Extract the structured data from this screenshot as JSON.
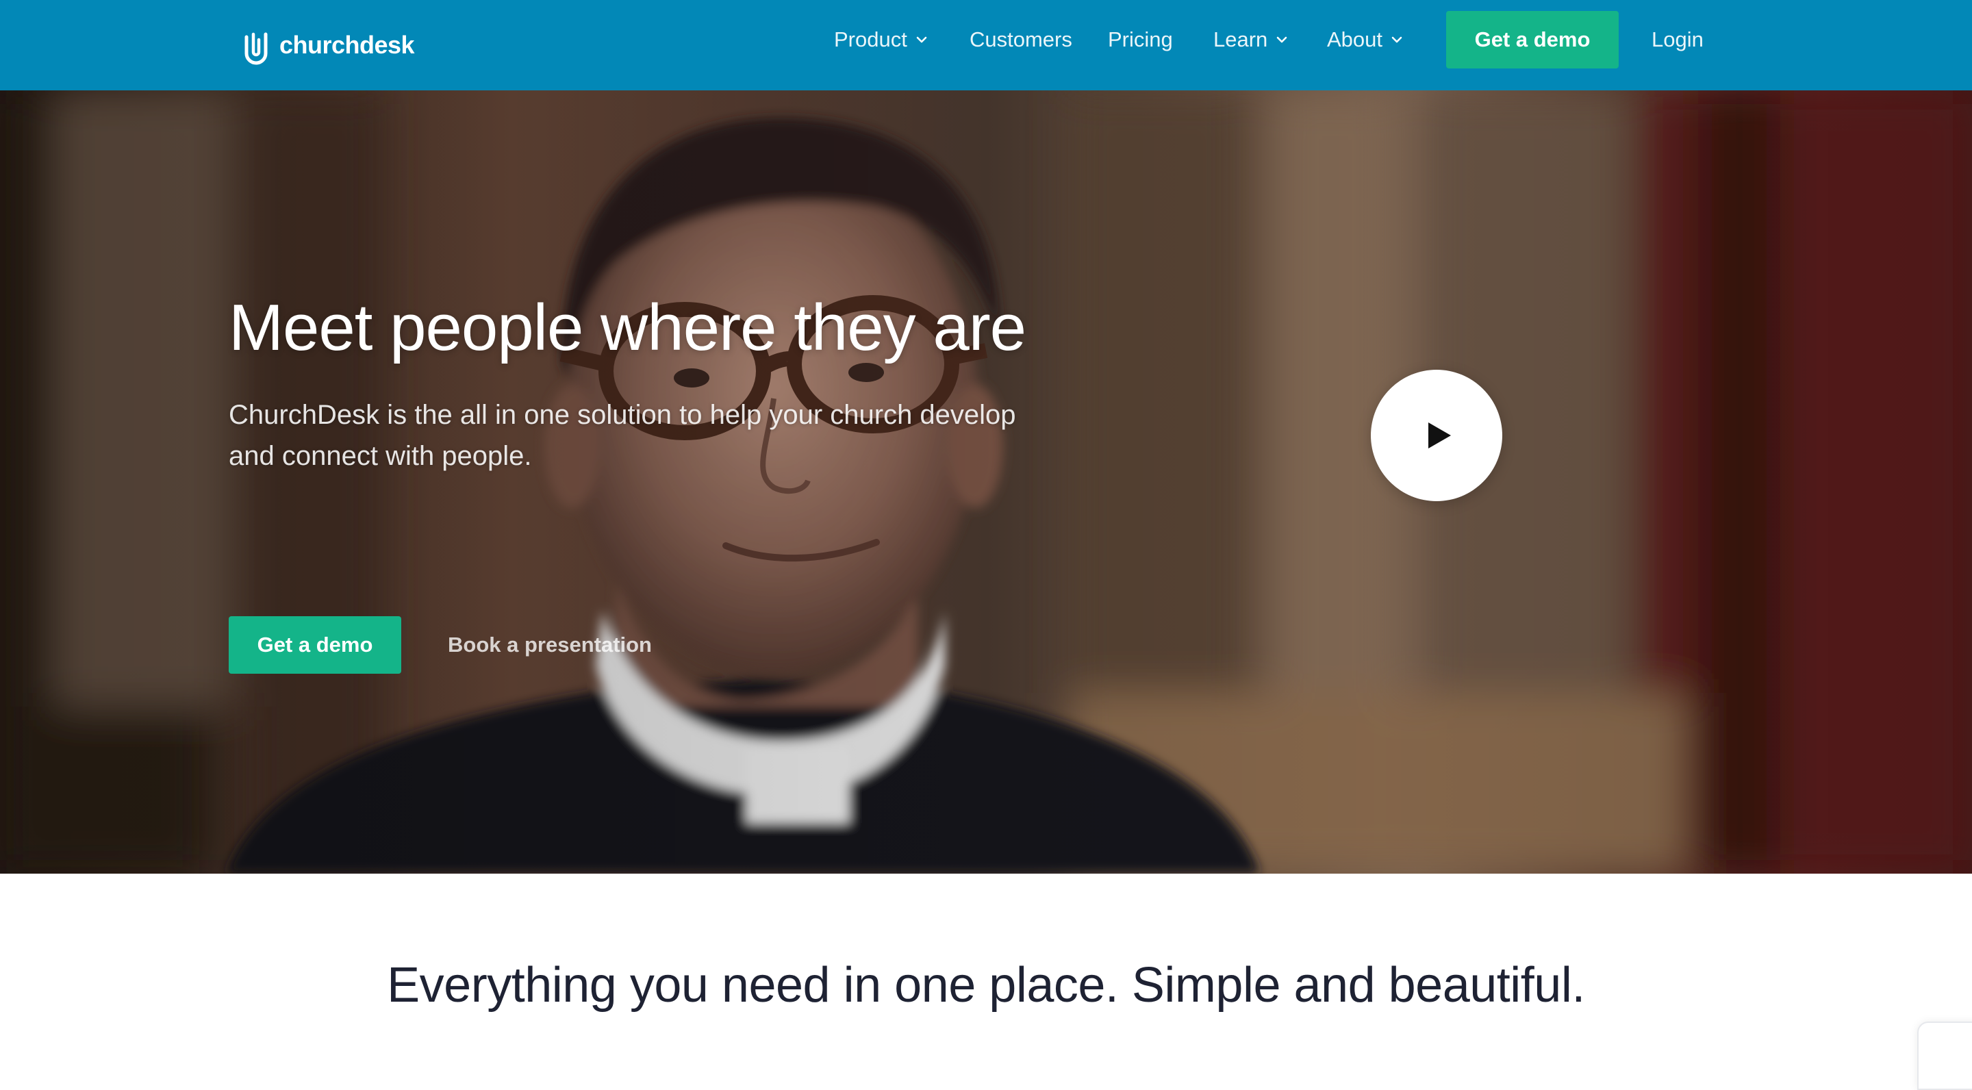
{
  "brand": {
    "name": "churchdesk",
    "nav_color": "#0288b7",
    "accent_color": "#14b489"
  },
  "nav": {
    "items": [
      {
        "label": "Product",
        "has_dropdown": true
      },
      {
        "label": "Customers",
        "has_dropdown": false
      },
      {
        "label": "Pricing",
        "has_dropdown": false
      },
      {
        "label": "Learn",
        "has_dropdown": true
      },
      {
        "label": "About",
        "has_dropdown": true
      }
    ],
    "demo_label": "Get a demo",
    "login_label": "Login"
  },
  "hero": {
    "title": "Meet people where they are",
    "subtitle": "ChurchDesk is the all in one solution to help your church develop and connect with people.",
    "primary_cta": "Get a demo",
    "secondary_cta": "Book a presentation",
    "play_icon": "play-icon"
  },
  "section": {
    "title": "Everything you need in one place. Simple and beautiful."
  }
}
